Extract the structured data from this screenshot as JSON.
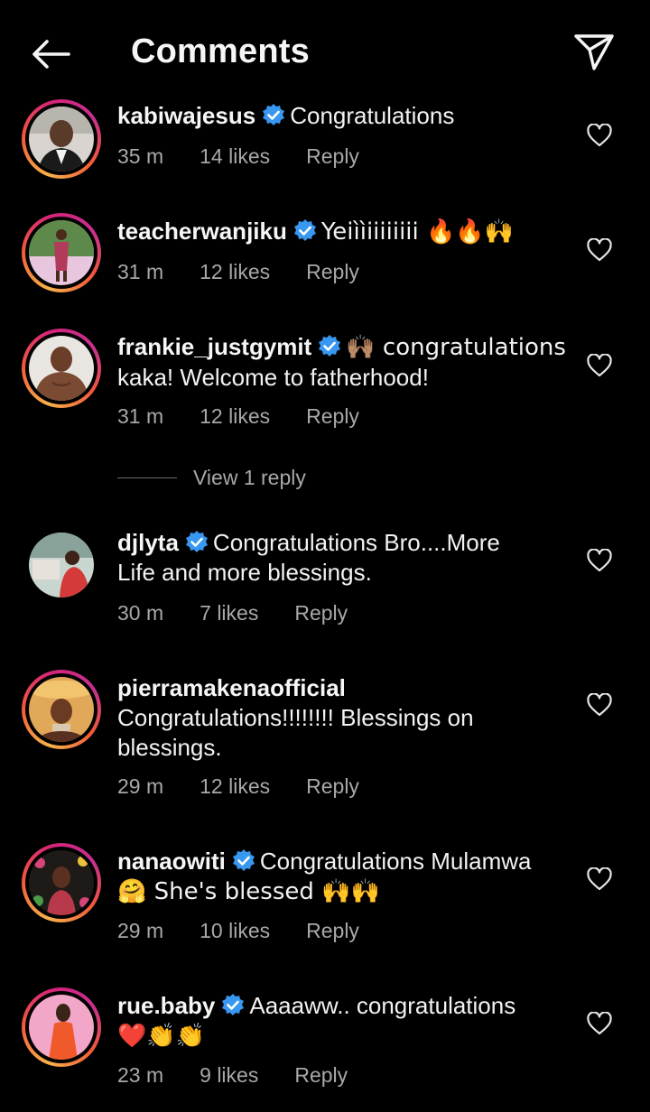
{
  "header": {
    "title": "Comments",
    "back_icon": "arrow-left-icon",
    "share_icon": "paper-plane-icon"
  },
  "colors": {
    "background": "#000000",
    "text": "#f5f5f5",
    "muted": "#a8a8a8",
    "verified": "#3897f0"
  },
  "comments": [
    {
      "username": "kabiwajesus",
      "verified": true,
      "text": "Congratulations",
      "text_line2": "",
      "time": "35 m",
      "likes": "14 likes",
      "reply": "Reply"
    },
    {
      "username": "teacherwanjiku",
      "verified": true,
      "text": "Yeiììiiiiiiii 🔥🔥🙌",
      "text_line2": "",
      "time": "31 m",
      "likes": "12 likes",
      "reply": "Reply"
    },
    {
      "username": "frankie_justgymit",
      "verified": true,
      "text": "🙌🏽 congratulations",
      "text_line2": "kaka! Welcome to fatherhood!",
      "time": "31 m",
      "likes": "12 likes",
      "reply": "Reply",
      "view_replies": "View 1 reply"
    },
    {
      "username": "djlyta",
      "verified": true,
      "text": "Congratulations Bro....More",
      "text_line2": "Life and more blessings.",
      "time": "30 m",
      "likes": "7 likes",
      "reply": "Reply"
    },
    {
      "username": "pierramakenaofficial",
      "verified": false,
      "text": "Congratulations!!!!!!!! Blessings on",
      "text_line2": "blessings.",
      "time": "29 m",
      "likes": "12 likes",
      "reply": "Reply"
    },
    {
      "username": "nanaowiti",
      "verified": true,
      "text": "Congratulations Mulamwa",
      "text_line2": "🤗 She's blessed 🙌🙌",
      "time": "29 m",
      "likes": "10 likes",
      "reply": "Reply"
    },
    {
      "username": "rue.baby",
      "verified": true,
      "text": "Aaaaww.. congratulations",
      "text_line2": "❤️👏👏",
      "time": "23 m",
      "likes": "9 likes",
      "reply": "Reply"
    }
  ]
}
